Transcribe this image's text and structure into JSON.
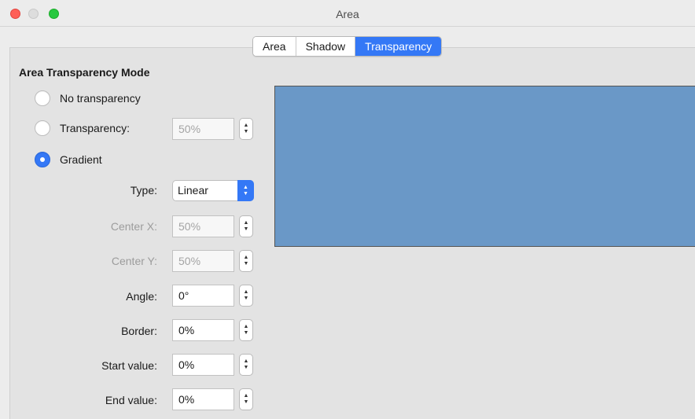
{
  "window": {
    "title": "Area"
  },
  "tabs": [
    {
      "label": "Area",
      "selected": false
    },
    {
      "label": "Shadow",
      "selected": false
    },
    {
      "label": "Transparency",
      "selected": true
    }
  ],
  "section": {
    "title": "Area Transparency Mode"
  },
  "radios": {
    "no_transparency": {
      "label": "No transparency",
      "checked": false
    },
    "transparency": {
      "label": "Transparency:",
      "checked": false,
      "value": "50%"
    },
    "gradient": {
      "label": "Gradient",
      "checked": true
    }
  },
  "gradient": {
    "type": {
      "label": "Type:",
      "value": "Linear"
    },
    "center_x": {
      "label": "Center X:",
      "value": "50%"
    },
    "center_y": {
      "label": "Center Y:",
      "value": "50%"
    },
    "angle": {
      "label": "Angle:",
      "value": "0°"
    },
    "border": {
      "label": "Border:",
      "value": "0%"
    },
    "start_value": {
      "label": "Start value:",
      "value": "0%"
    },
    "end_value": {
      "label": "End value:",
      "value": "0%"
    }
  },
  "colors": {
    "accent": "#3478f6",
    "preview_fill": "#6a98c7"
  }
}
